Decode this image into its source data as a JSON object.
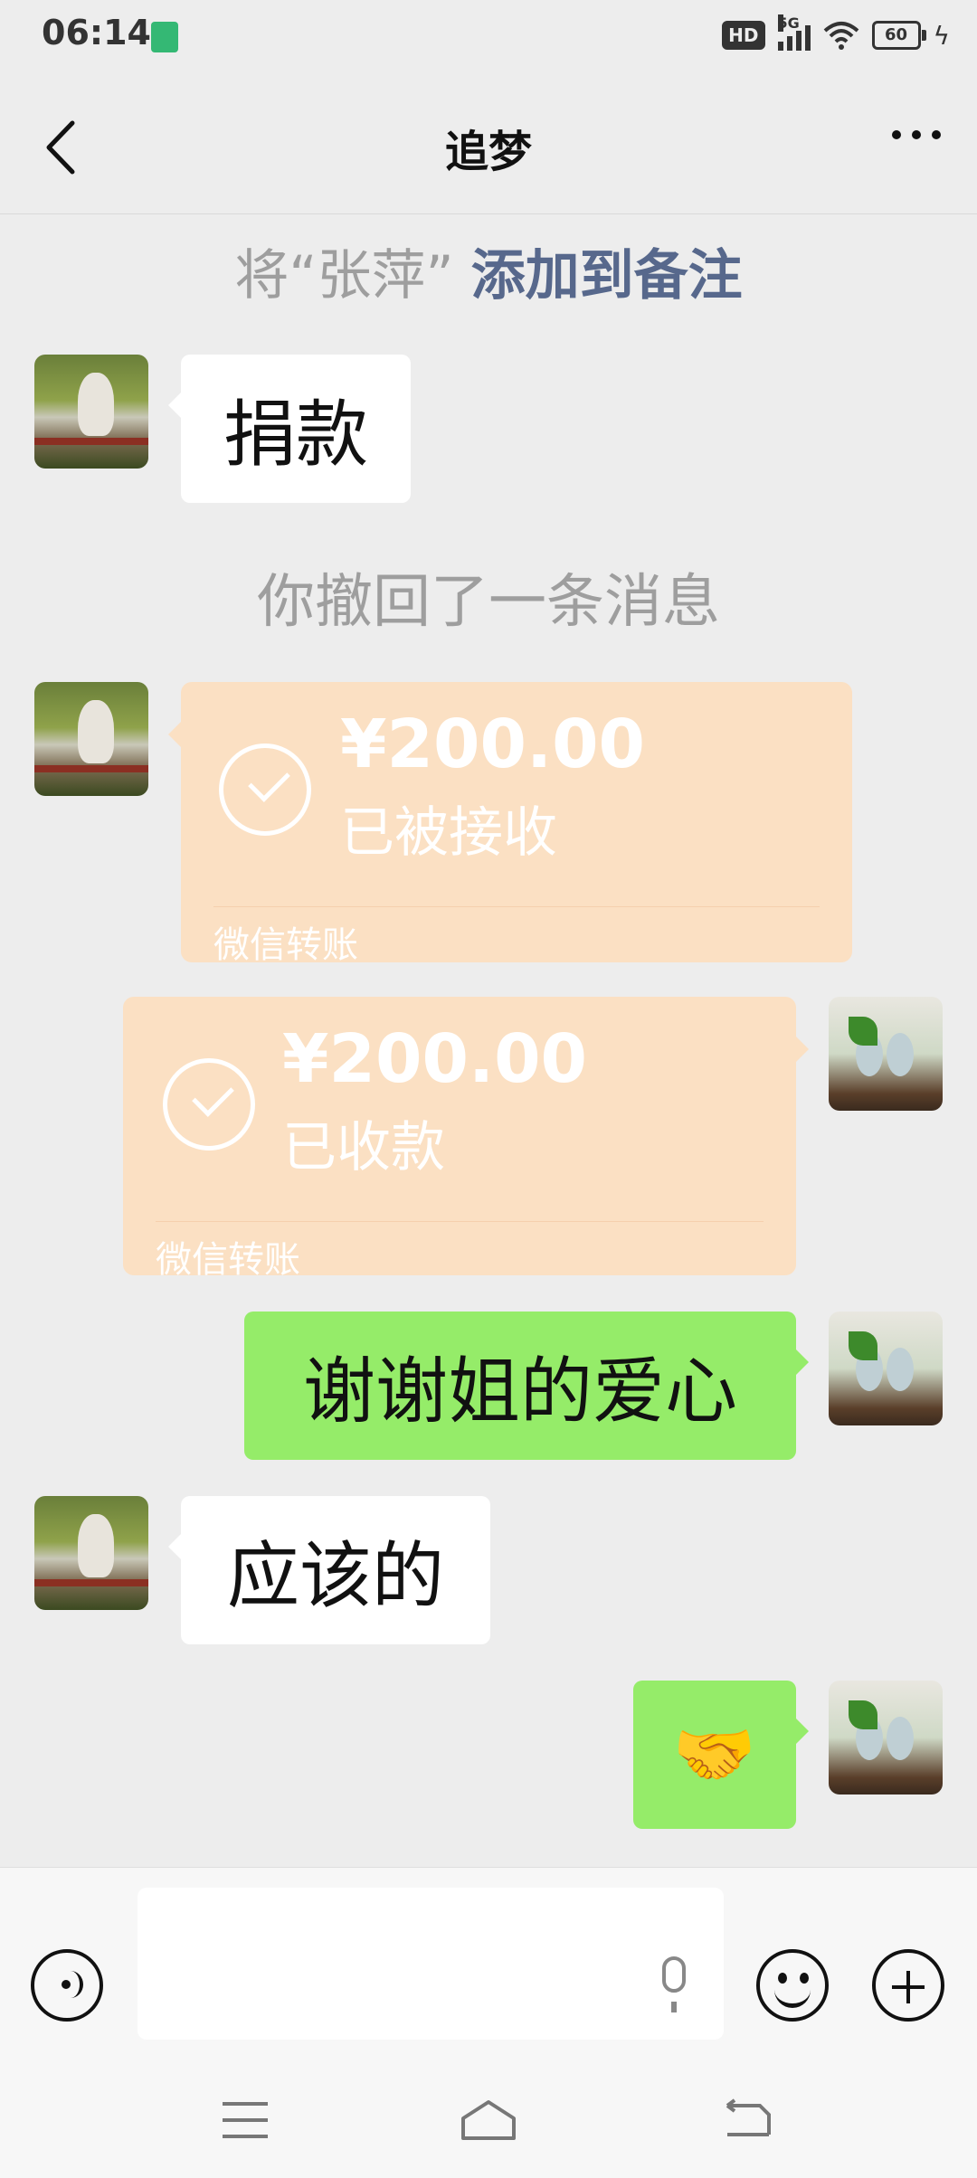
{
  "status_bar": {
    "time": "06:14",
    "hd": "HD",
    "network": "5G",
    "battery": "60"
  },
  "header": {
    "title": "追梦"
  },
  "notice": {
    "prefix": "将“张萍”",
    "link": "添加到备注"
  },
  "messages": {
    "m1": "捐款",
    "recall": "你撤回了一条消息",
    "transfer1": {
      "amount": "¥200.00",
      "status": "已被接收",
      "footer": "微信转账"
    },
    "transfer2": {
      "amount": "¥200.00",
      "status": "已收款",
      "footer": "微信转账"
    },
    "m2": "谢谢姐的爱心",
    "m3": "应该的",
    "m4": "🤝"
  },
  "colors": {
    "background": "#ededed",
    "sent_bubble": "#95ec69",
    "received_bubble": "#ffffff",
    "transfer_bubble": "#fbe0c3",
    "link": "#57688c"
  }
}
